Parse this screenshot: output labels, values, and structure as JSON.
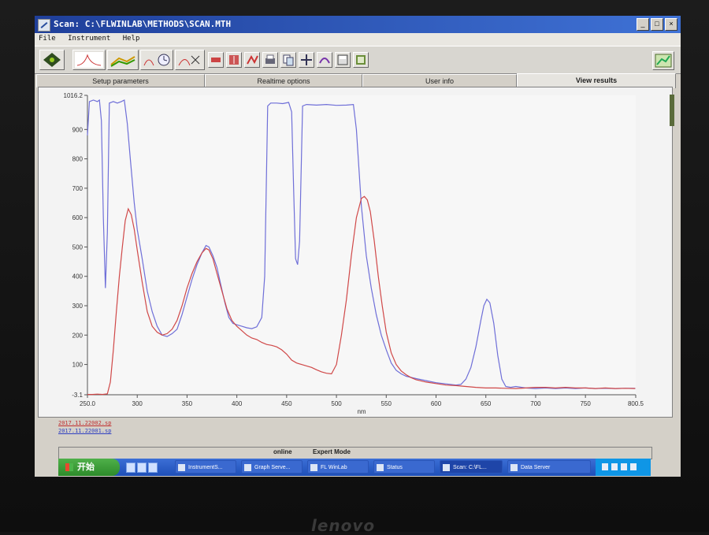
{
  "window": {
    "title": "Scan: C:\\FLWINLAB\\METHODS\\SCAN.MTH",
    "controls": [
      "_",
      "□",
      "×"
    ]
  },
  "menu": [
    "File",
    "Instrument",
    "Help"
  ],
  "toolbar_icons": [
    "traffic-light-icon",
    "single-scan-icon",
    "multi-scan-icon",
    "clock-scan-icon",
    "overlay-scan-icon",
    "zoom-icon",
    "vertical-scale-icon",
    "peak-pick-icon",
    "print-icon",
    "copy-icon",
    "move-icon",
    "smooth-icon",
    "save-icon",
    "export-icon",
    "graph-view-icon"
  ],
  "tabs": [
    "Setup parameters",
    "Realtime options",
    "User info",
    "View results"
  ],
  "active_tab": "View results",
  "chart_data": {
    "type": "line",
    "xlabel": "nm",
    "ylabel": "",
    "xlim": [
      250,
      800.5
    ],
    "ylim": [
      -3.1,
      1016.2
    ],
    "x_ticks": [
      "250.0",
      "300",
      "350",
      "400",
      "450",
      "500",
      "550",
      "600",
      "650",
      "700",
      "750",
      "800.5"
    ],
    "y_ticks": [
      "-3.1",
      "100",
      "200",
      "300",
      "400",
      "500",
      "600",
      "700",
      "800",
      "900",
      "1016.2"
    ],
    "series": [
      {
        "name": "2017.11.22001.sp",
        "color": "#6f6fd8",
        "points": [
          [
            250,
            880
          ],
          [
            252,
            995
          ],
          [
            256,
            1000
          ],
          [
            260,
            995
          ],
          [
            262,
            1000
          ],
          [
            264,
            930
          ],
          [
            266,
            600
          ],
          [
            268,
            360
          ],
          [
            270,
            550
          ],
          [
            272,
            990
          ],
          [
            276,
            995
          ],
          [
            280,
            990
          ],
          [
            284,
            995
          ],
          [
            287,
            1000
          ],
          [
            290,
            920
          ],
          [
            293,
            800
          ],
          [
            297,
            650
          ],
          [
            300,
            560
          ],
          [
            305,
            460
          ],
          [
            310,
            350
          ],
          [
            315,
            280
          ],
          [
            320,
            230
          ],
          [
            325,
            200
          ],
          [
            330,
            195
          ],
          [
            335,
            205
          ],
          [
            340,
            220
          ],
          [
            345,
            270
          ],
          [
            350,
            330
          ],
          [
            355,
            390
          ],
          [
            360,
            440
          ],
          [
            365,
            480
          ],
          [
            369,
            505
          ],
          [
            372,
            500
          ],
          [
            376,
            470
          ],
          [
            380,
            430
          ],
          [
            384,
            370
          ],
          [
            388,
            310
          ],
          [
            392,
            260
          ],
          [
            396,
            240
          ],
          [
            400,
            235
          ],
          [
            405,
            230
          ],
          [
            410,
            225
          ],
          [
            415,
            222
          ],
          [
            420,
            228
          ],
          [
            425,
            260
          ],
          [
            428,
            400
          ],
          [
            431,
            980
          ],
          [
            434,
            990
          ],
          [
            440,
            990
          ],
          [
            446,
            988
          ],
          [
            452,
            992
          ],
          [
            455,
            960
          ],
          [
            457,
            700
          ],
          [
            459,
            460
          ],
          [
            461,
            440
          ],
          [
            463,
            520
          ],
          [
            466,
            980
          ],
          [
            470,
            985
          ],
          [
            480,
            983
          ],
          [
            490,
            985
          ],
          [
            500,
            982
          ],
          [
            510,
            983
          ],
          [
            517,
            985
          ],
          [
            520,
            900
          ],
          [
            525,
            640
          ],
          [
            530,
            470
          ],
          [
            535,
            360
          ],
          [
            540,
            270
          ],
          [
            545,
            200
          ],
          [
            550,
            150
          ],
          [
            555,
            105
          ],
          [
            560,
            80
          ],
          [
            565,
            68
          ],
          [
            570,
            60
          ],
          [
            580,
            52
          ],
          [
            590,
            45
          ],
          [
            600,
            38
          ],
          [
            610,
            34
          ],
          [
            620,
            30
          ],
          [
            625,
            32
          ],
          [
            630,
            50
          ],
          [
            635,
            90
          ],
          [
            640,
            160
          ],
          [
            645,
            250
          ],
          [
            648,
            300
          ],
          [
            651,
            322
          ],
          [
            654,
            310
          ],
          [
            658,
            240
          ],
          [
            662,
            130
          ],
          [
            666,
            50
          ],
          [
            670,
            25
          ],
          [
            675,
            22
          ],
          [
            680,
            25
          ],
          [
            690,
            20
          ],
          [
            700,
            18
          ],
          [
            710,
            20
          ],
          [
            720,
            18
          ],
          [
            730,
            20
          ],
          [
            740,
            18
          ],
          [
            750,
            20
          ],
          [
            760,
            18
          ],
          [
            770,
            19
          ],
          [
            780,
            18
          ],
          [
            790,
            19
          ],
          [
            800,
            19
          ]
        ]
      },
      {
        "name": "2017.11.22002.sp",
        "color": "#d04848",
        "points": [
          [
            250,
            -2
          ],
          [
            255,
            -2
          ],
          [
            260,
            -1
          ],
          [
            265,
            -2
          ],
          [
            270,
            0
          ],
          [
            273,
            40
          ],
          [
            276,
            150
          ],
          [
            279,
            280
          ],
          [
            282,
            400
          ],
          [
            285,
            500
          ],
          [
            288,
            590
          ],
          [
            291,
            630
          ],
          [
            294,
            610
          ],
          [
            297,
            560
          ],
          [
            300,
            490
          ],
          [
            305,
            380
          ],
          [
            310,
            280
          ],
          [
            315,
            230
          ],
          [
            320,
            210
          ],
          [
            325,
            200
          ],
          [
            330,
            205
          ],
          [
            335,
            220
          ],
          [
            340,
            250
          ],
          [
            345,
            300
          ],
          [
            350,
            360
          ],
          [
            355,
            410
          ],
          [
            360,
            450
          ],
          [
            365,
            480
          ],
          [
            369,
            495
          ],
          [
            372,
            490
          ],
          [
            376,
            460
          ],
          [
            380,
            410
          ],
          [
            385,
            350
          ],
          [
            390,
            290
          ],
          [
            395,
            250
          ],
          [
            400,
            230
          ],
          [
            405,
            215
          ],
          [
            410,
            200
          ],
          [
            415,
            190
          ],
          [
            420,
            185
          ],
          [
            425,
            175
          ],
          [
            430,
            168
          ],
          [
            435,
            165
          ],
          [
            440,
            160
          ],
          [
            445,
            150
          ],
          [
            450,
            135
          ],
          [
            455,
            115
          ],
          [
            460,
            105
          ],
          [
            465,
            100
          ],
          [
            470,
            95
          ],
          [
            475,
            90
          ],
          [
            480,
            82
          ],
          [
            485,
            75
          ],
          [
            490,
            70
          ],
          [
            495,
            68
          ],
          [
            500,
            100
          ],
          [
            505,
            200
          ],
          [
            510,
            320
          ],
          [
            515,
            470
          ],
          [
            520,
            600
          ],
          [
            525,
            665
          ],
          [
            528,
            672
          ],
          [
            531,
            660
          ],
          [
            534,
            620
          ],
          [
            538,
            520
          ],
          [
            542,
            400
          ],
          [
            546,
            300
          ],
          [
            550,
            210
          ],
          [
            555,
            140
          ],
          [
            560,
            100
          ],
          [
            565,
            78
          ],
          [
            570,
            65
          ],
          [
            575,
            55
          ],
          [
            580,
            48
          ],
          [
            590,
            40
          ],
          [
            600,
            35
          ],
          [
            610,
            30
          ],
          [
            620,
            28
          ],
          [
            630,
            25
          ],
          [
            640,
            22
          ],
          [
            650,
            20
          ],
          [
            660,
            20
          ],
          [
            670,
            19
          ],
          [
            680,
            18
          ],
          [
            690,
            20
          ],
          [
            700,
            22
          ],
          [
            710,
            22
          ],
          [
            720,
            20
          ],
          [
            730,
            22
          ],
          [
            740,
            20
          ],
          [
            750,
            20
          ],
          [
            760,
            18
          ],
          [
            770,
            20
          ],
          [
            780,
            18
          ],
          [
            790,
            19
          ],
          [
            800,
            18
          ]
        ]
      }
    ]
  },
  "legend": [
    "2017.11.22002.sp",
    "2017.11.22001.sp"
  ],
  "status_bar": {
    "state": "online",
    "mode": "Expert Mode"
  },
  "taskbar": {
    "start_label": "开始",
    "tasks": [
      "InstrumentS...",
      "Graph Serve...",
      "FL WinLab",
      "Status",
      "Scan: C:\\FL...",
      "Data Server"
    ]
  }
}
